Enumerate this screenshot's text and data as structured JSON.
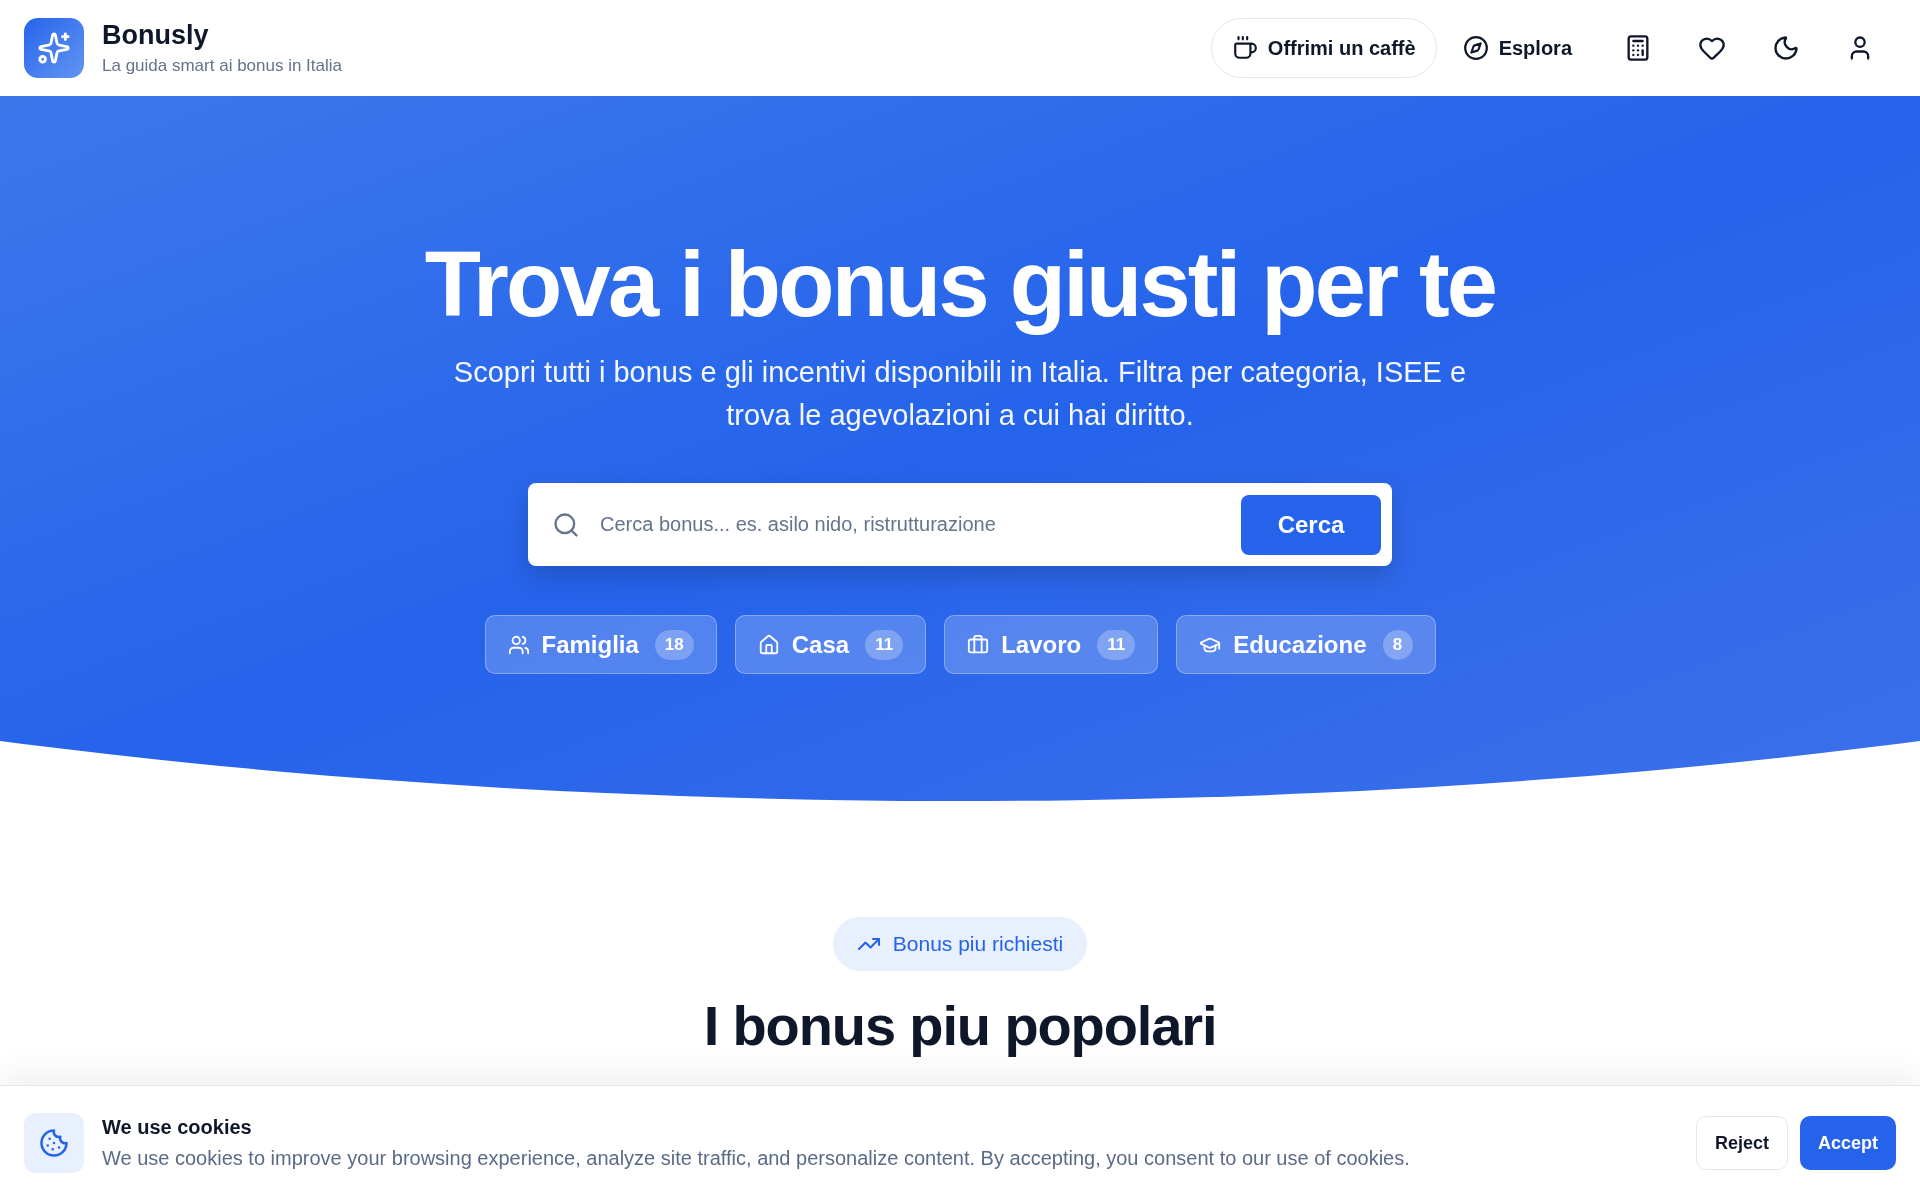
{
  "header": {
    "brand": {
      "name": "Bonusly",
      "tagline": "La guida smart ai bonus in Italia"
    },
    "nav": [
      {
        "kind": "outlined",
        "label": "Offrimi un caffè"
      },
      {
        "kind": "plain",
        "label": "Esplora"
      }
    ]
  },
  "hero": {
    "title": "Trova i bonus giusti per te",
    "subtitle": "Scopri tutti i bonus e gli incentivi disponibili in Italia. Filtra per categoria, ISEE e trova le agevolazioni a cui hai diritto.",
    "search": {
      "placeholder": "Cerca bonus... es. asilo nido, ristrutturazione",
      "button": "Cerca"
    },
    "categories": [
      {
        "label": "Famiglia",
        "count": "18"
      },
      {
        "label": "Casa",
        "count": "11"
      },
      {
        "label": "Lavoro",
        "count": "11"
      },
      {
        "label": "Educazione",
        "count": "8"
      }
    ]
  },
  "popular": {
    "tag": "Bonus piu richiesti",
    "title": "I bonus piu popolari"
  },
  "cookie_banner": {
    "title": "We use cookies",
    "message": "We use cookies to improve your browsing experience, analyze site traffic, and personalize content. By accepting, you consent to our use of cookies.",
    "buttons": [
      {
        "kind": "secondary",
        "label": "Reject"
      },
      {
        "kind": "primary",
        "label": "Accept"
      }
    ]
  }
}
